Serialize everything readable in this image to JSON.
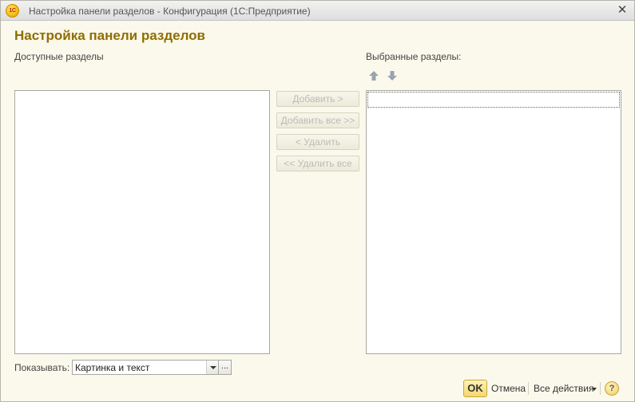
{
  "window": {
    "logo_text": "1С",
    "title": "Настройка панели разделов - Конфигурация  (1С:Предприятие)",
    "close_glyph": "✕"
  },
  "form": {
    "title": "Настройка панели разделов"
  },
  "available": {
    "label": "Доступные разделы",
    "items": []
  },
  "selected": {
    "label": "Выбранные разделы:",
    "items": [],
    "move_up_icon": "arrow-up-icon",
    "move_down_icon": "arrow-down-icon"
  },
  "buttons": {
    "add": "Добавить >",
    "add_all": "Добавить все >>",
    "remove": "< Удалить",
    "remove_all": "<< Удалить все"
  },
  "show": {
    "label": "Показывать:",
    "value": "Картинка и текст",
    "more_glyph": "..."
  },
  "footer": {
    "ok": "OK",
    "cancel": "Отмена",
    "all_actions": "Все действия",
    "help": "?"
  },
  "colors": {
    "accent_title": "#8f6e00",
    "background": "#fbf9ec",
    "arrow_disabled": "#9aa3b0"
  }
}
